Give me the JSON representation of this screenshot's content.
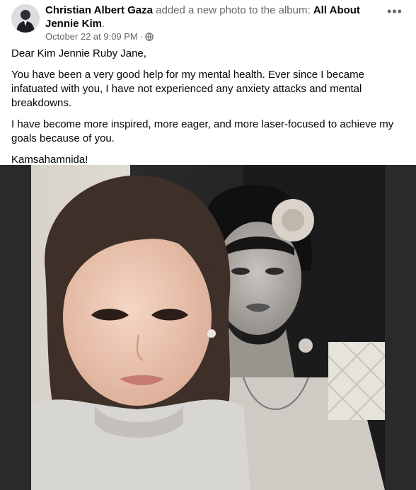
{
  "post": {
    "author": "Christian Albert Gaza",
    "action_text": " added a new photo to the album: ",
    "album": "All About Jennie Kim",
    "album_end": ".",
    "timestamp": "October 22 at 9:09 PM",
    "separator": "·",
    "privacy_icon": "globe-icon",
    "more_icon": "more-options-icon",
    "paragraphs": [
      "Dear Kim Jennie Ruby Jane,",
      "You have been a very good help for my mental health. Ever since I became infatuated with you, I have not experienced any anxiety attacks and mental breakdowns.",
      "I have become more inspired, more eager, and more laser-focused to achieve my goals because of you.",
      "Kamsahamnida!"
    ]
  },
  "colors": {
    "text_primary": "#050505",
    "text_secondary": "#65676b",
    "photo_backdrop": "#2b2a2a"
  }
}
